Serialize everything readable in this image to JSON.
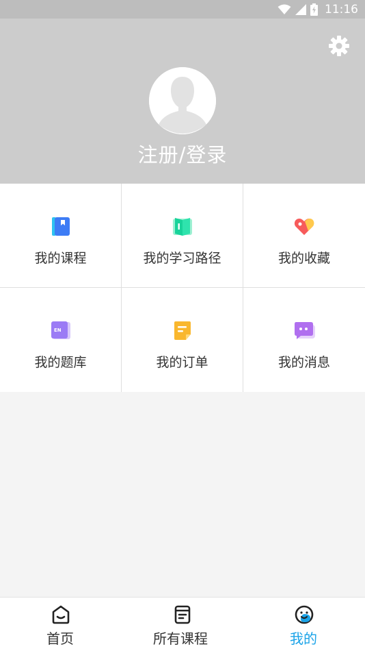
{
  "status_bar": {
    "time": "11:16",
    "icons": [
      "wifi-icon",
      "signal-icon",
      "battery-icon"
    ]
  },
  "header": {
    "login_label": "注册/登录",
    "avatar_icon": "default-avatar-icon",
    "settings_icon": "gear-icon"
  },
  "menu": {
    "items": [
      {
        "label": "我的课程",
        "icon": "course-book-icon",
        "color": "#3d8bf5"
      },
      {
        "label": "我的学习路径",
        "icon": "learning-path-icon",
        "color": "#22d39b"
      },
      {
        "label": "我的收藏",
        "icon": "heart-tag-icon",
        "color": "#f75b5b"
      },
      {
        "label": "我的题库",
        "icon": "question-bank-icon",
        "color": "#9b7bf5"
      },
      {
        "label": "我的订单",
        "icon": "order-note-icon",
        "color": "#f9b72e"
      },
      {
        "label": "我的消息",
        "icon": "message-bubble-icon",
        "color": "#b77af0"
      }
    ]
  },
  "bottom_nav": {
    "items": [
      {
        "label": "首页",
        "icon": "home-icon",
        "active": false
      },
      {
        "label": "所有课程",
        "icon": "courses-icon",
        "active": false
      },
      {
        "label": "我的",
        "icon": "profile-face-icon",
        "active": true
      }
    ],
    "active_color": "#1aa3e8",
    "inactive_color": "#333333"
  }
}
